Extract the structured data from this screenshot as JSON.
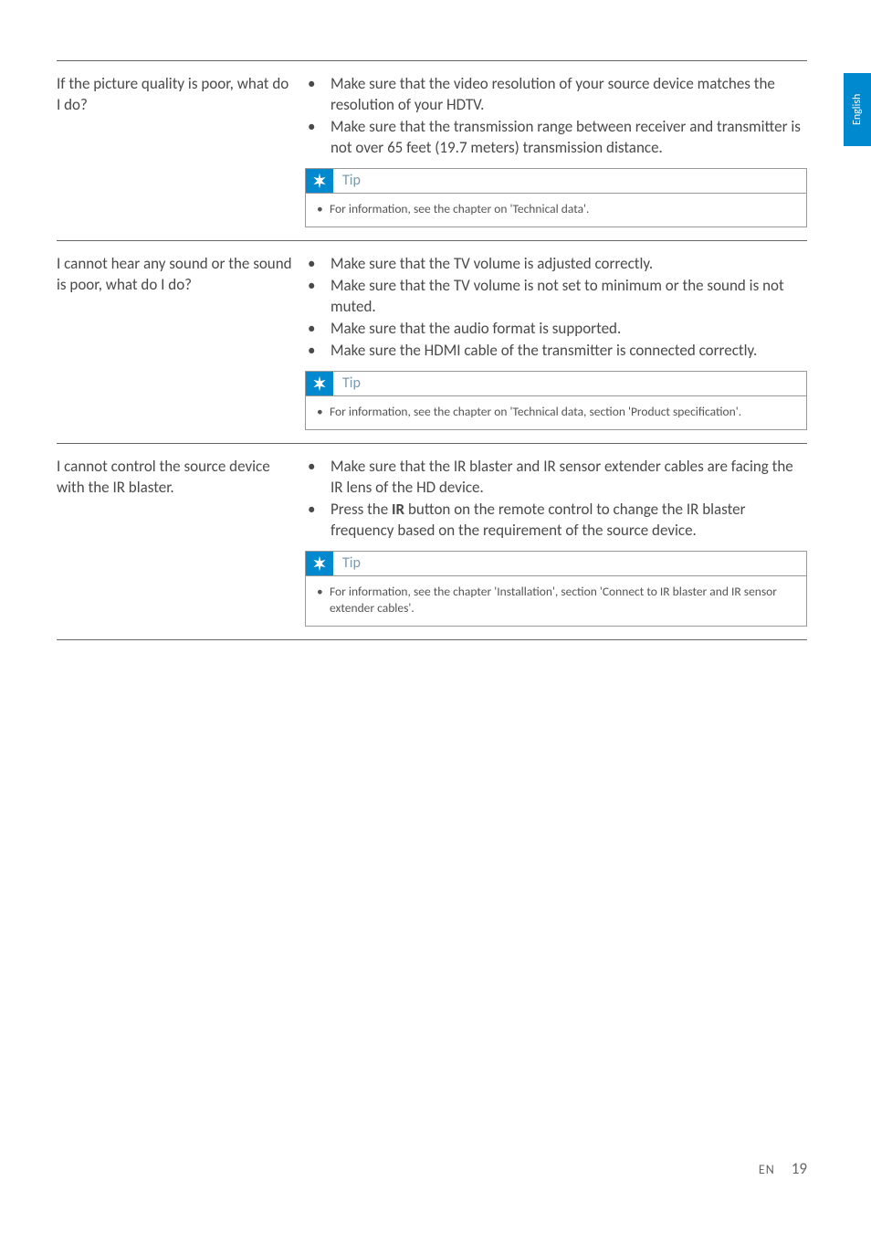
{
  "langTab": "English",
  "sections": [
    {
      "question": "If the picture quality is poor, what do I do?",
      "bullets": [
        "Make sure that the video resolution of your source device matches the resolution of your HDTV.",
        "Make sure that the transmission range between receiver and transmitter is not over 65 feet (19.7 meters) transmission distance."
      ],
      "tipLabel": "Tip",
      "tipText": "For information, see the chapter on 'Technical data'."
    },
    {
      "question": "I cannot hear any sound or the sound is poor, what do I do?",
      "bullets": [
        "Make sure that the TV volume is adjusted correctly.",
        "Make sure that the TV volume is not set to minimum or the sound is not muted.",
        "Make sure that the audio format is supported.",
        "Make sure the HDMI cable of the transmitter is connected correctly."
      ],
      "tipLabel": "Tip",
      "tipText": "For information, see the chapter on 'Technical data, section 'Product specification'."
    },
    {
      "question": "I cannot control the source device with the IR blaster.",
      "bullets": [
        "Make sure that the IR blaster and IR sensor extender cables are facing the IR lens of the HD device.",
        "Press the <b>IR</b> button on the remote control to change the IR blaster frequency based on the requirement of the source device."
      ],
      "tipLabel": "Tip",
      "tipText": "For information, see the chapter 'Installation', section 'Connect to IR blaster and IR sensor extender cables'."
    }
  ],
  "footer": {
    "lang": "EN",
    "page": "19"
  }
}
